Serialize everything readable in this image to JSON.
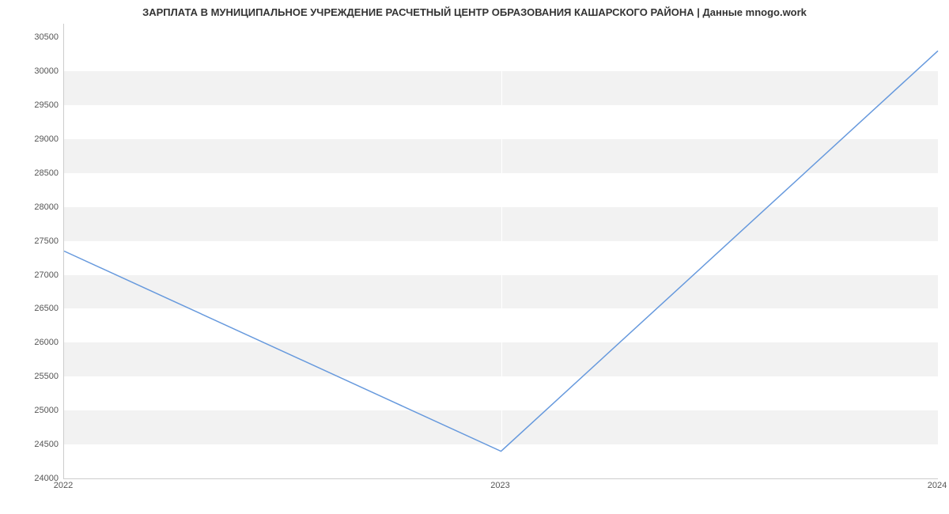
{
  "chart_data": {
    "type": "line",
    "title": "ЗАРПЛАТА В МУНИЦИПАЛЬНОЕ УЧРЕЖДЕНИЕ РАСЧЕТНЫЙ ЦЕНТР ОБРАЗОВАНИЯ КАШАРСКОГО РАЙОНА | Данные mnogo.work",
    "x": [
      "2022",
      "2023",
      "2024"
    ],
    "values": [
      27350,
      24400,
      30300
    ],
    "y_ticks": [
      24000,
      24500,
      25000,
      25500,
      26000,
      26500,
      27000,
      27500,
      28000,
      28500,
      29000,
      29500,
      30000,
      30500
    ],
    "x_ticks": [
      "2022",
      "2023",
      "2024"
    ],
    "ylim": [
      24000,
      30700
    ],
    "line_color": "#6699dd"
  }
}
